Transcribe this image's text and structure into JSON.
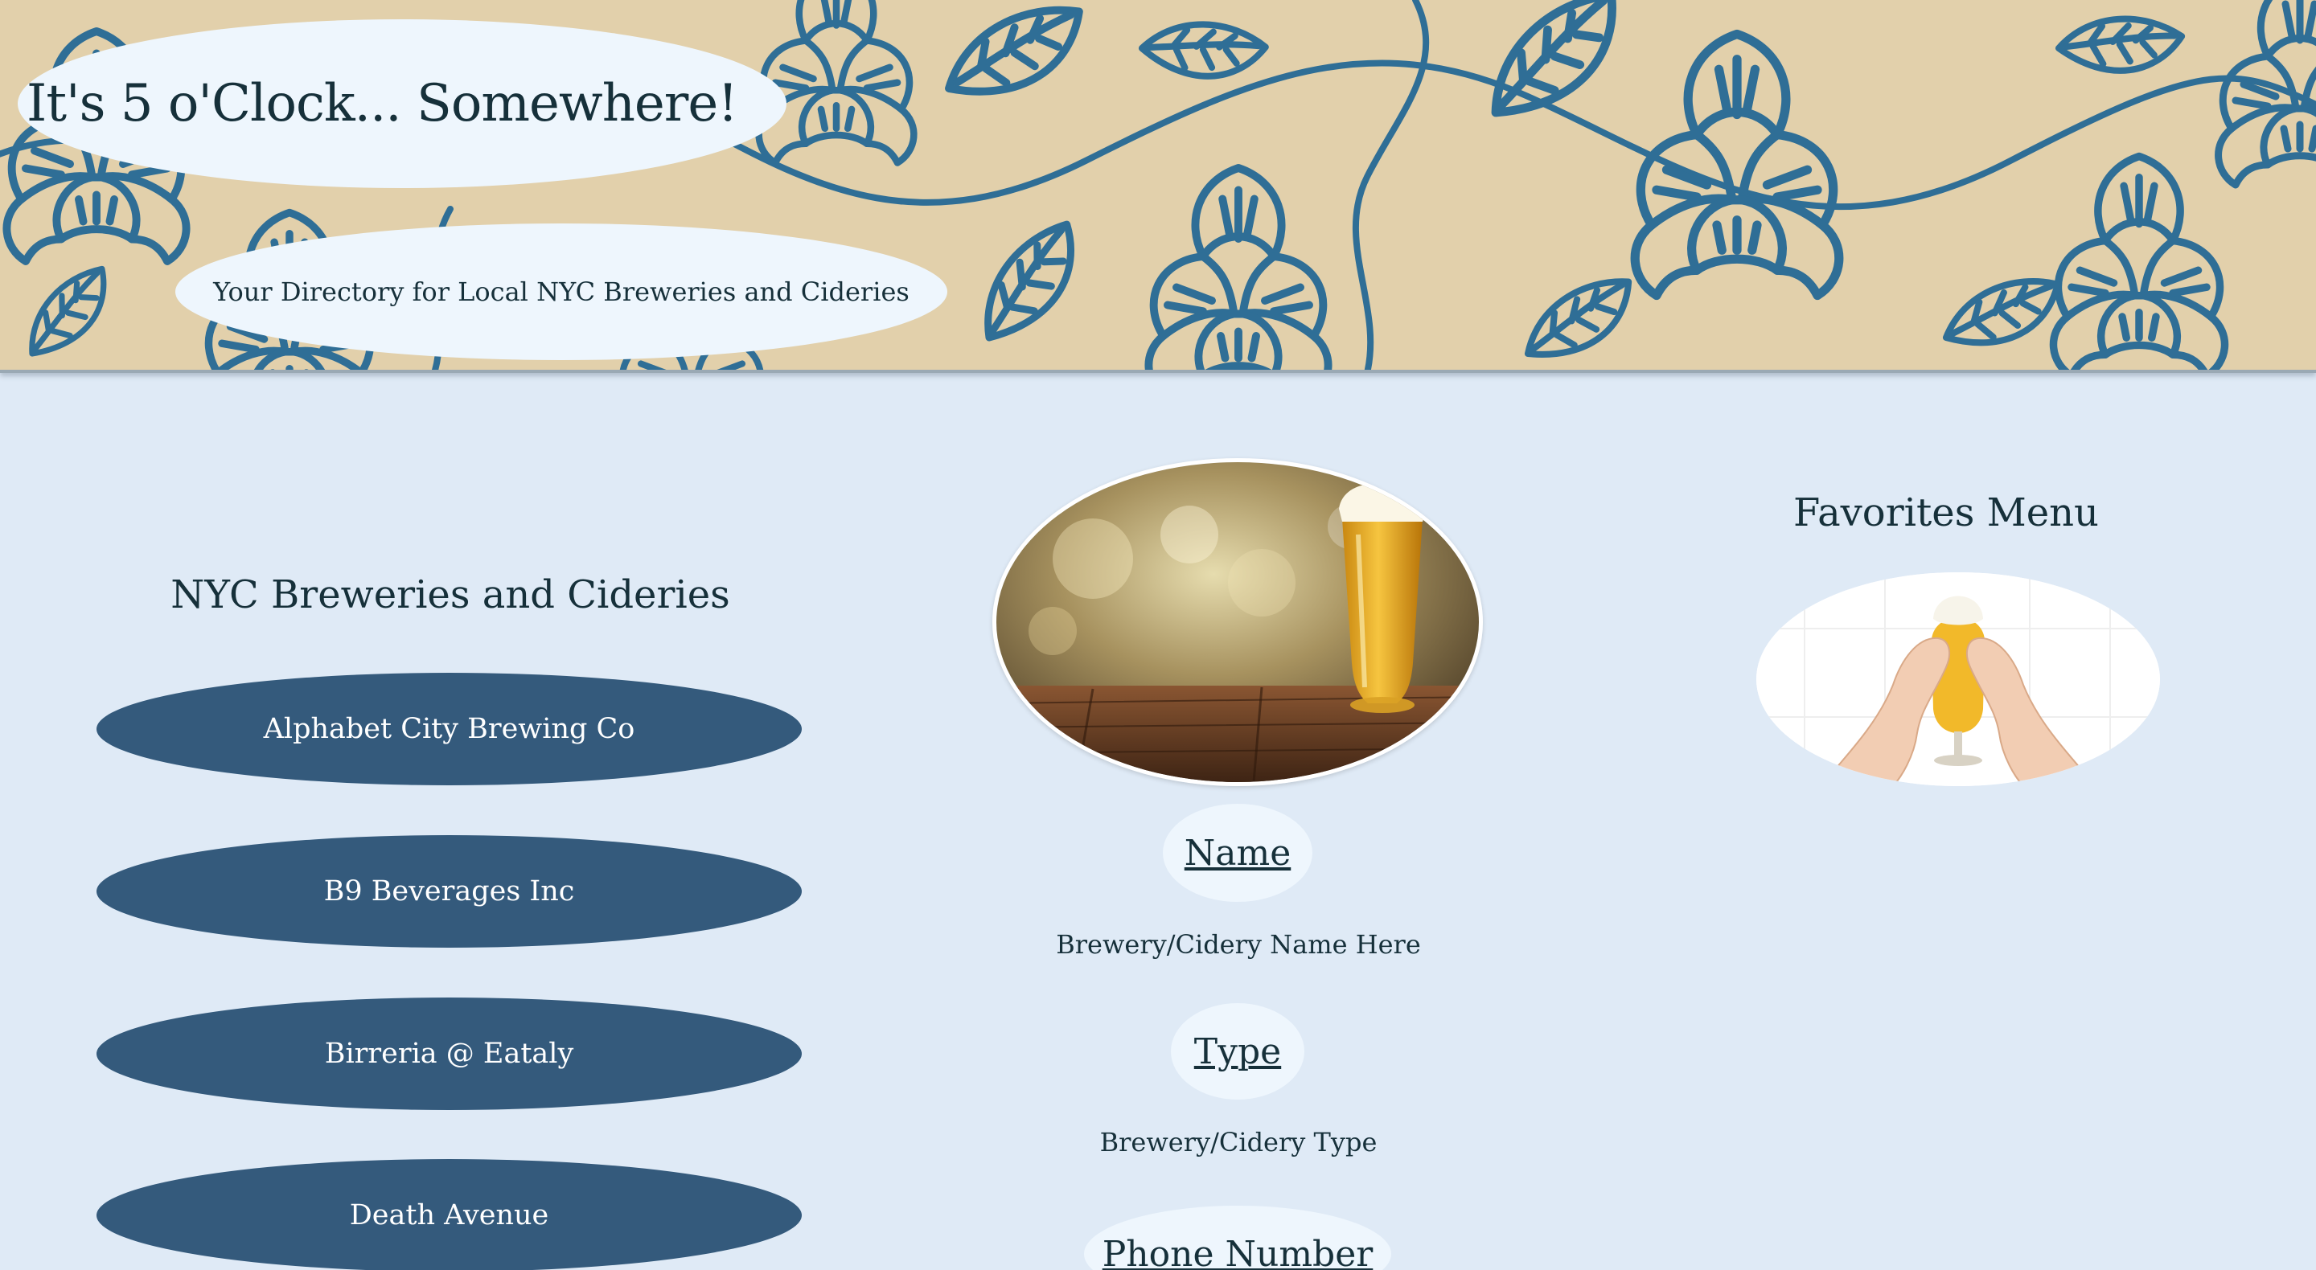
{
  "header": {
    "title": "It's 5 o'Clock... Somewhere!",
    "subtitle": "Your Directory for Local NYC Breweries and Cideries"
  },
  "left": {
    "heading": "NYC Breweries and Cideries",
    "breweries": [
      "Alphabet City Brewing Co",
      "B9 Beverages Inc",
      "Birreria @ Eataly",
      "Death Avenue"
    ]
  },
  "details": {
    "name_label": "Name",
    "name_value": "Brewery/Cidery Name Here",
    "type_label": "Type",
    "type_value": "Brewery/Cidery Type",
    "phone_label": "Phone Number"
  },
  "favorites": {
    "heading": "Favorites Menu"
  },
  "colors": {
    "page_background": "#dfeaf6",
    "banner_background": "#e2d0ab",
    "banner_pattern": "#2f6e96",
    "oval_background": "#eef6fd",
    "button_background": "#345a7c",
    "button_text": "#ffffff",
    "text": "#16303a"
  },
  "icons": {
    "banner": "hop-flower-pattern",
    "center_image": "beer-glass-on-table-photo",
    "favorites_image": "heart-hands-beer-photo"
  }
}
